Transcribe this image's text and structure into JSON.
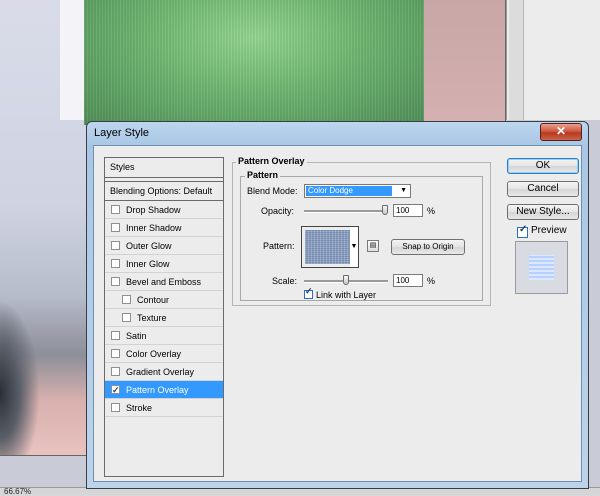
{
  "dialog": {
    "title": "Layer Style",
    "close_glyph": "✕"
  },
  "styles_panel": {
    "header": "Styles",
    "blending_options": "Blending Options: Default",
    "items": [
      {
        "label": "Drop Shadow",
        "checked": false,
        "sub": false,
        "active": false
      },
      {
        "label": "Inner Shadow",
        "checked": false,
        "sub": false,
        "active": false
      },
      {
        "label": "Outer Glow",
        "checked": false,
        "sub": false,
        "active": false
      },
      {
        "label": "Inner Glow",
        "checked": false,
        "sub": false,
        "active": false
      },
      {
        "label": "Bevel and Emboss",
        "checked": false,
        "sub": false,
        "active": false
      },
      {
        "label": "Contour",
        "checked": false,
        "sub": true,
        "active": false
      },
      {
        "label": "Texture",
        "checked": false,
        "sub": true,
        "active": false
      },
      {
        "label": "Satin",
        "checked": false,
        "sub": false,
        "active": false
      },
      {
        "label": "Color Overlay",
        "checked": false,
        "sub": false,
        "active": false
      },
      {
        "label": "Gradient Overlay",
        "checked": false,
        "sub": false,
        "active": false
      },
      {
        "label": "Pattern Overlay",
        "checked": true,
        "sub": false,
        "active": true
      },
      {
        "label": "Stroke",
        "checked": false,
        "sub": false,
        "active": false
      }
    ]
  },
  "pattern_overlay": {
    "section_title": "Pattern Overlay",
    "group_title": "Pattern",
    "blend_mode_label": "Blend Mode:",
    "blend_mode_value": "Color Dodge",
    "opacity_label": "Opacity:",
    "opacity_value": "100",
    "opacity_percent": 1.0,
    "opacity_unit": "%",
    "pattern_label": "Pattern:",
    "snap_button": "Snap to Origin",
    "scale_label": "Scale:",
    "scale_value": "100",
    "scale_unit": "%",
    "link_with_layer_label": "Link with Layer",
    "link_with_layer_checked": true
  },
  "actions": {
    "ok": "OK",
    "cancel": "Cancel",
    "new_style": "New Style...",
    "preview_label": "Preview",
    "preview_checked": true
  },
  "statusbar": {
    "text": "66.67%"
  },
  "colors": {
    "selection": "#3399ff",
    "dialog_frame": "#a9c6e4",
    "close_button": "#c7472e"
  }
}
